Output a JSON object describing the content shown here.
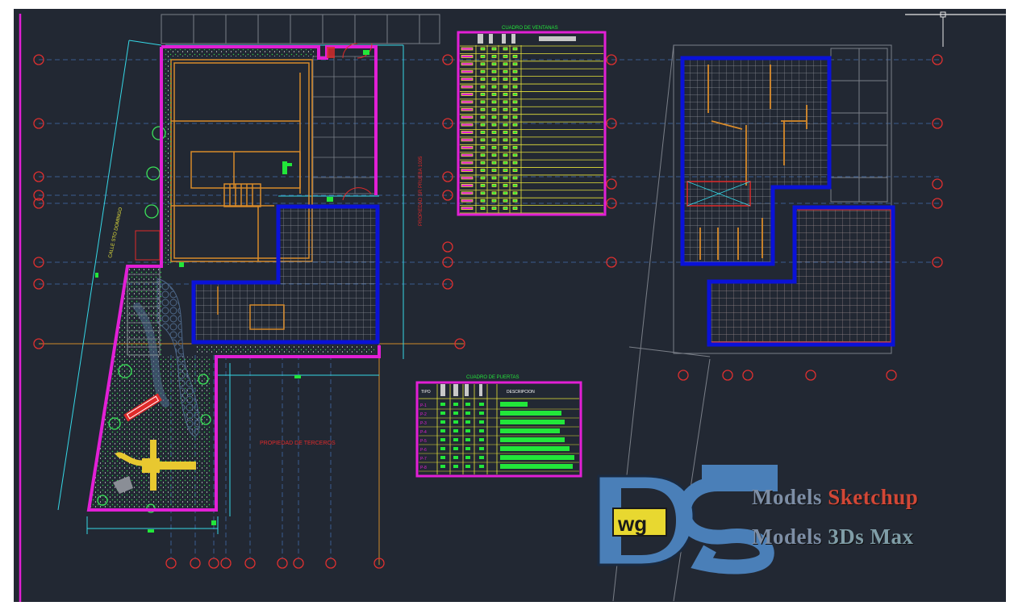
{
  "colors": {
    "background": "#222833",
    "magenta": "#e21fd6",
    "orange": "#d88a2a",
    "blue": "#0a12d8",
    "green": "#22e63a",
    "cyan": "#35d7e6",
    "grid": "#8a8e96",
    "red": "#e02a2a",
    "yellow": "#e6e23a"
  },
  "labels": {
    "street": "CALLE STO DOMINGO",
    "neighbor_side": "PROPIEDAD SR PRUEBA 1005",
    "neighbor_bottom": "PROPIEDAD DE TERCEROS"
  },
  "window_table": {
    "title": "CUADRO DE VENTANAS",
    "rows": 22
  },
  "door_table": {
    "title": "CUADRO DE PUERTAS",
    "type_header": "TIPO",
    "desc_header": "DESCRIPCION",
    "rows": [
      "P-1",
      "P-2",
      "P-3",
      "P-4",
      "P-5",
      "P-6",
      "P-7",
      "P-8"
    ]
  },
  "watermark": {
    "logo_text": "wg",
    "line1_a": "Models ",
    "line1_b": "Sketchup",
    "line2_a": "Models ",
    "line2_b": "3Ds Max"
  }
}
